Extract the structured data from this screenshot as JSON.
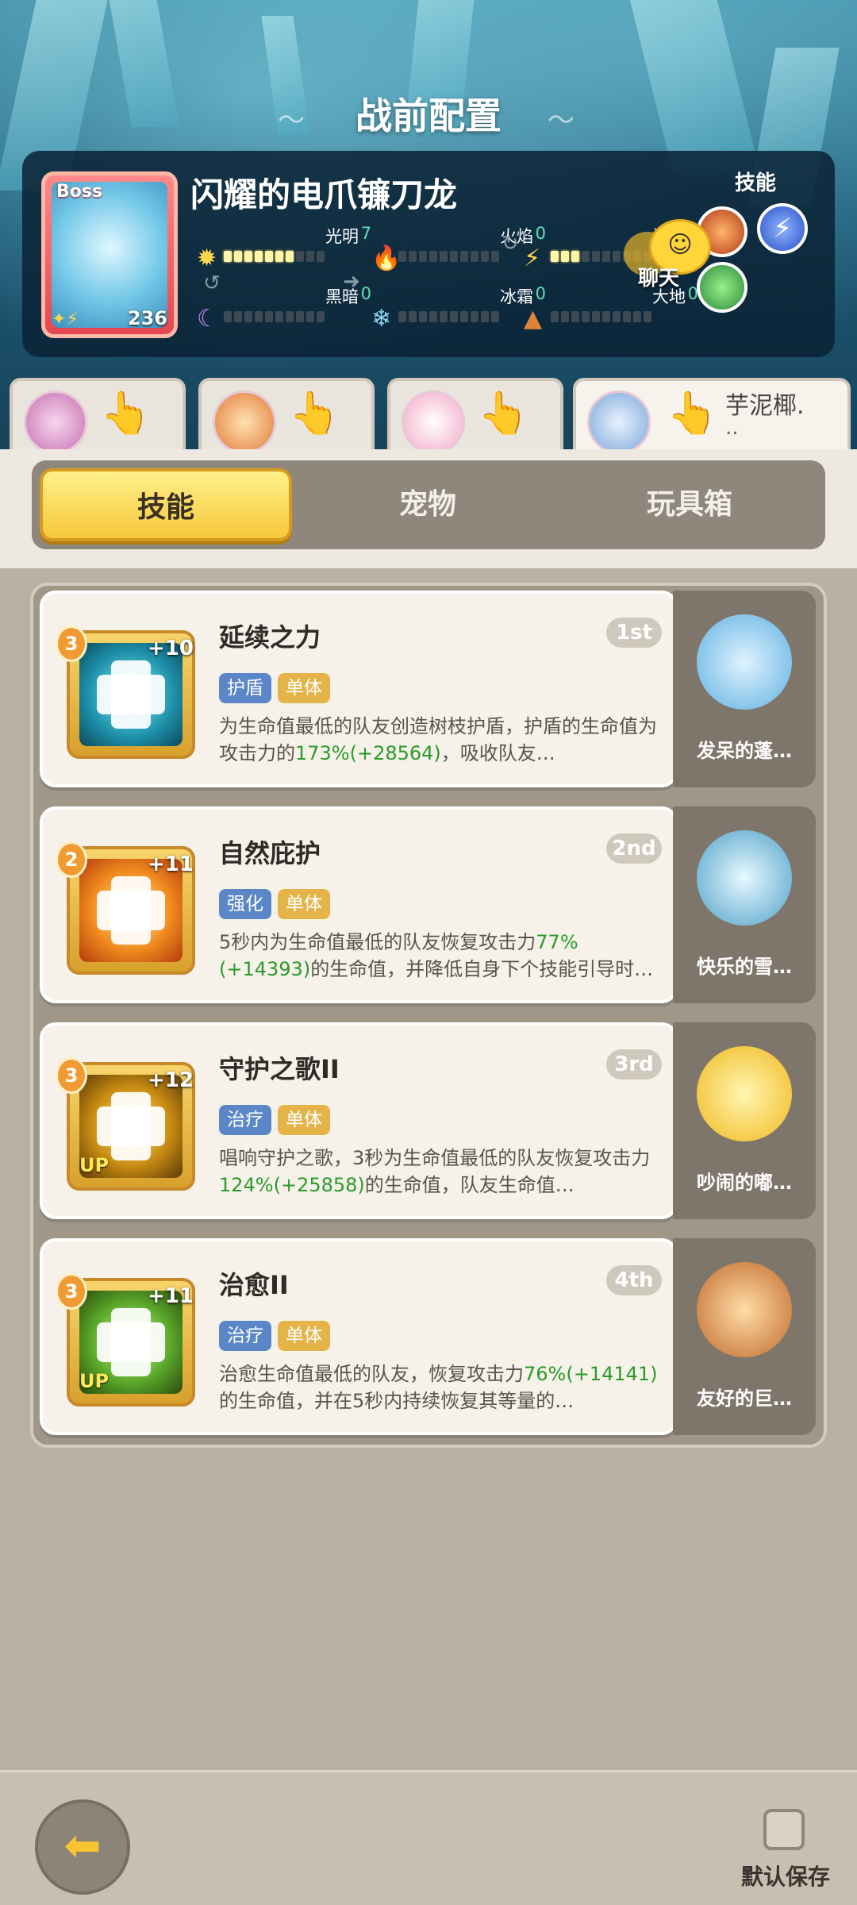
{
  "header": {
    "title": "战前配置"
  },
  "boss": {
    "tag": "Boss",
    "name": "闪耀的电爪镰刀龙",
    "level": "236",
    "skills_label": "技能",
    "elements": [
      {
        "label": "光明",
        "value": "7",
        "icon": "sun-icon",
        "fill": 7
      },
      {
        "label": "火焰",
        "value": "0",
        "icon": "flame-icon",
        "fill": 0
      },
      {
        "label": "闪电",
        "value": "3",
        "icon": "lightning-icon",
        "fill": 3
      },
      {
        "label": "黑暗",
        "value": "0",
        "icon": "moon-icon",
        "fill": 0
      },
      {
        "label": "冰霜",
        "value": "0",
        "icon": "snowflake-icon",
        "fill": 0
      },
      {
        "label": "大地",
        "value": "0",
        "icon": "earth-icon",
        "fill": 0
      }
    ]
  },
  "chat": {
    "label": "聊天"
  },
  "team": {
    "active_name": "芋泥椰.",
    "active_suffix": ".."
  },
  "tabs": [
    {
      "label": "技能",
      "active": true
    },
    {
      "label": "宠物",
      "active": false
    },
    {
      "label": "玩具箱",
      "active": false
    }
  ],
  "skills": [
    {
      "name": "延续之力",
      "rank": "1st",
      "level": "3",
      "plus": "+10",
      "tags": [
        "护盾",
        "单体"
      ],
      "desc_pre": "为生命值最低的队友创造树枝护盾，护盾的生命值为攻击力的",
      "desc_hl": "173%(+28564)",
      "desc_post": "，吸收队友…",
      "pet": "发呆的蓬…",
      "up": false
    },
    {
      "name": "自然庇护",
      "rank": "2nd",
      "level": "2",
      "plus": "+11",
      "tags": [
        "强化",
        "单体"
      ],
      "desc_pre": "5秒内为生命值最低的队友恢复攻击力",
      "desc_hl": "77%(+14393)",
      "desc_post": "的生命值，并降低自身下个技能引导时…",
      "pet": "快乐的雪…",
      "up": false
    },
    {
      "name": "守护之歌II",
      "rank": "3rd",
      "level": "3",
      "plus": "+12",
      "tags": [
        "治疗",
        "单体"
      ],
      "desc_pre": "唱响守护之歌，3秒为生命值最低的队友恢复攻击力",
      "desc_hl": "124%(+25858)",
      "desc_post": "的生命值，队友生命值…",
      "pet": "吵闹的嘟…",
      "up": true
    },
    {
      "name": "治愈II",
      "rank": "4th",
      "level": "3",
      "plus": "+11",
      "tags": [
        "治疗",
        "单体"
      ],
      "desc_pre": "治愈生命值最低的队友，恢复攻击力",
      "desc_hl": "76%(+14141)",
      "desc_post": "的生命值，并在5秒内持续恢复其等量的…",
      "pet": "友好的巨…",
      "up": true
    }
  ],
  "footer": {
    "save_label": "默认保存"
  },
  "colors": {
    "accent_gold": "#f6c83a",
    "heal_green": "#2a9a2a",
    "tag_blue": "#5b86c8",
    "tag_gold": "#e4b448"
  }
}
